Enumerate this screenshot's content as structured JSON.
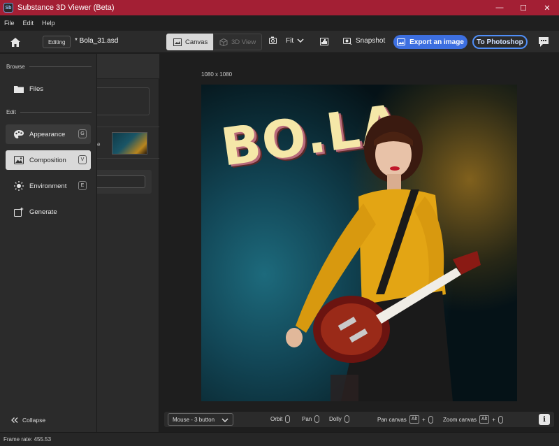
{
  "window": {
    "title": "Substance 3D Viewer (Beta)",
    "app_icon_text": "Sb",
    "controls": {
      "minimize": "—",
      "maximize": "☐",
      "close": "✕"
    }
  },
  "menu": [
    "File",
    "Edit",
    "Help"
  ],
  "toolbar": {
    "mode_badge": "Editing",
    "document_title": "* Bola_31.asd",
    "canvas_label": "Canvas",
    "view3d_label": "3D View",
    "fit_label": "Fit",
    "snapshot_label": "Snapshot",
    "export_label": "Export an image",
    "photoshop_label": "To Photoshop"
  },
  "leftnav": {
    "browse_heading": "Browse",
    "edit_heading": "Edit",
    "items": [
      {
        "label": "Files",
        "shortcut": ""
      },
      {
        "label": "Appearance",
        "shortcut": "G"
      },
      {
        "label": "Composition",
        "shortcut": "V"
      },
      {
        "label": "Environment",
        "shortcut": "E"
      },
      {
        "label": "Generate",
        "shortcut": ""
      }
    ],
    "selected": "Composition",
    "collapse_label": "Collapse"
  },
  "sidepanel": {
    "partial_letter": "e"
  },
  "canvas": {
    "dimensions_label": "1080 x 1080",
    "artwork_text": "BO.LA"
  },
  "controls": {
    "mouse_mode": "Mouse - 3 button",
    "orbit": "Orbit",
    "pan": "Pan",
    "dolly": "Dolly",
    "pan_canvas": "Pan canvas",
    "zoom_canvas": "Zoom canvas",
    "alt_key": "Alt",
    "plus": "+",
    "info": "i"
  },
  "status": {
    "frame_rate": "Frame rate: 455.53"
  },
  "colors": {
    "titlebar": "#a31f34",
    "accent": "#3d6fe0",
    "accent_outline": "#4f8ef7"
  }
}
